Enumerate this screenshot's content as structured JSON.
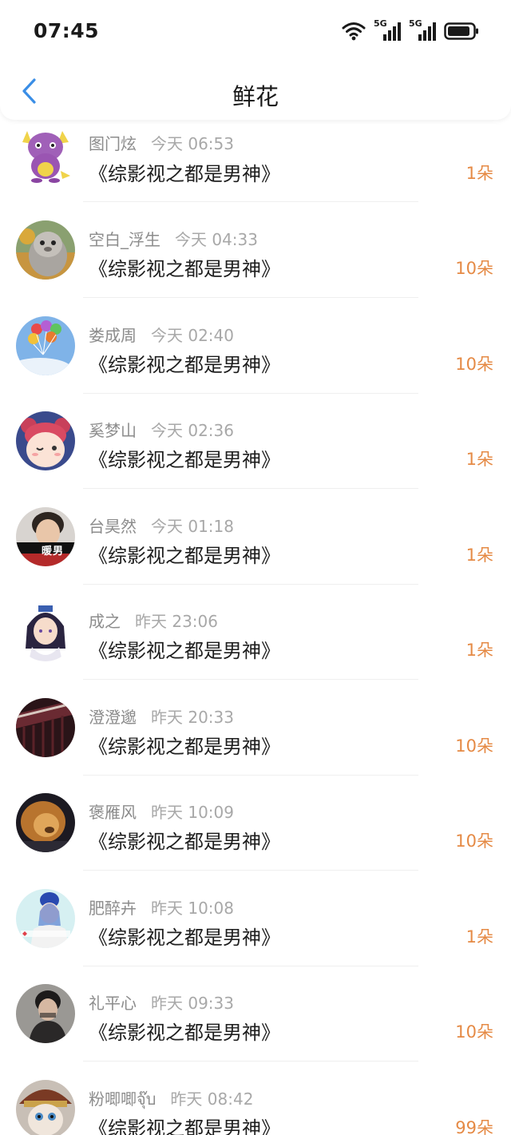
{
  "status_bar": {
    "time": "07:45",
    "signal1_label": "5G",
    "signal2_label": "5G"
  },
  "nav": {
    "title": "鲜花"
  },
  "colors": {
    "accent_blue": "#3a8ee6",
    "count_orange": "#e58a45"
  },
  "records": [
    {
      "name": "图门炫",
      "time": "今天 06:53",
      "book": "《综影视之都是男神》",
      "count": "1朵",
      "avatar": "purple-creature"
    },
    {
      "name": "空白_浮生",
      "time": "今天 04:33",
      "book": "《综影视之都是男神》",
      "count": "10朵",
      "avatar": "plush-toy"
    },
    {
      "name": "娄成周",
      "time": "今天 02:40",
      "book": "《综影视之都是男神》",
      "count": "10朵",
      "avatar": "balloons"
    },
    {
      "name": "奚梦山",
      "time": "今天 02:36",
      "book": "《综影视之都是男神》",
      "count": "1朵",
      "avatar": "cartoon-girl"
    },
    {
      "name": "台昊然",
      "time": "今天 01:18",
      "book": "《综影视之都是男神》",
      "count": "1朵",
      "avatar": "boy-photo",
      "avatar_caption": "暖男"
    },
    {
      "name": "成之",
      "time": "昨天 23:06",
      "book": "《综影视之都是男神》",
      "count": "1朵",
      "avatar": "anime-character"
    },
    {
      "name": "澄澄邈",
      "time": "昨天 20:33",
      "book": "《综影视之都是男神》",
      "count": "10朵",
      "avatar": "dark-photo"
    },
    {
      "name": "褒雁风",
      "time": "昨天 10:09",
      "book": "《综影视之都是男神》",
      "count": "10朵",
      "avatar": "lion"
    },
    {
      "name": "肥醉卉",
      "time": "昨天 10:08",
      "book": "《综影视之都是男神》",
      "count": "1朵",
      "avatar": "blue-hair-girl"
    },
    {
      "name": "礼平心",
      "time": "昨天 09:33",
      "book": "《综影视之都是男神》",
      "count": "10朵",
      "avatar": "man-photo"
    },
    {
      "name": "粉唧唧จุ๊บ",
      "time": "昨天 08:42",
      "book": "《综影视之都是男神》",
      "count": "99朵",
      "avatar": "cat-hat"
    }
  ]
}
